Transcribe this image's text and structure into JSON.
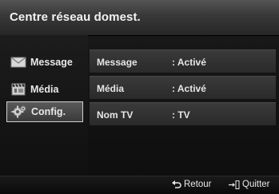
{
  "title": "Centre réseau domest.",
  "sidebar": {
    "items": [
      {
        "label": "Message",
        "icon": "envelope-icon"
      },
      {
        "label": "Média",
        "icon": "film-icon"
      },
      {
        "label": "Config.",
        "icon": "gear-icon",
        "selected": true
      }
    ]
  },
  "settings": [
    {
      "name": "Message",
      "value": ": Activé"
    },
    {
      "name": "Média",
      "value": ": Activé"
    },
    {
      "name": "Nom TV",
      "value": ": TV"
    }
  ],
  "footer": {
    "back_label": "Retour",
    "exit_label": "Quitter"
  },
  "colors": {
    "selection_border": "#cfcfcf",
    "row_background": "#333333"
  }
}
